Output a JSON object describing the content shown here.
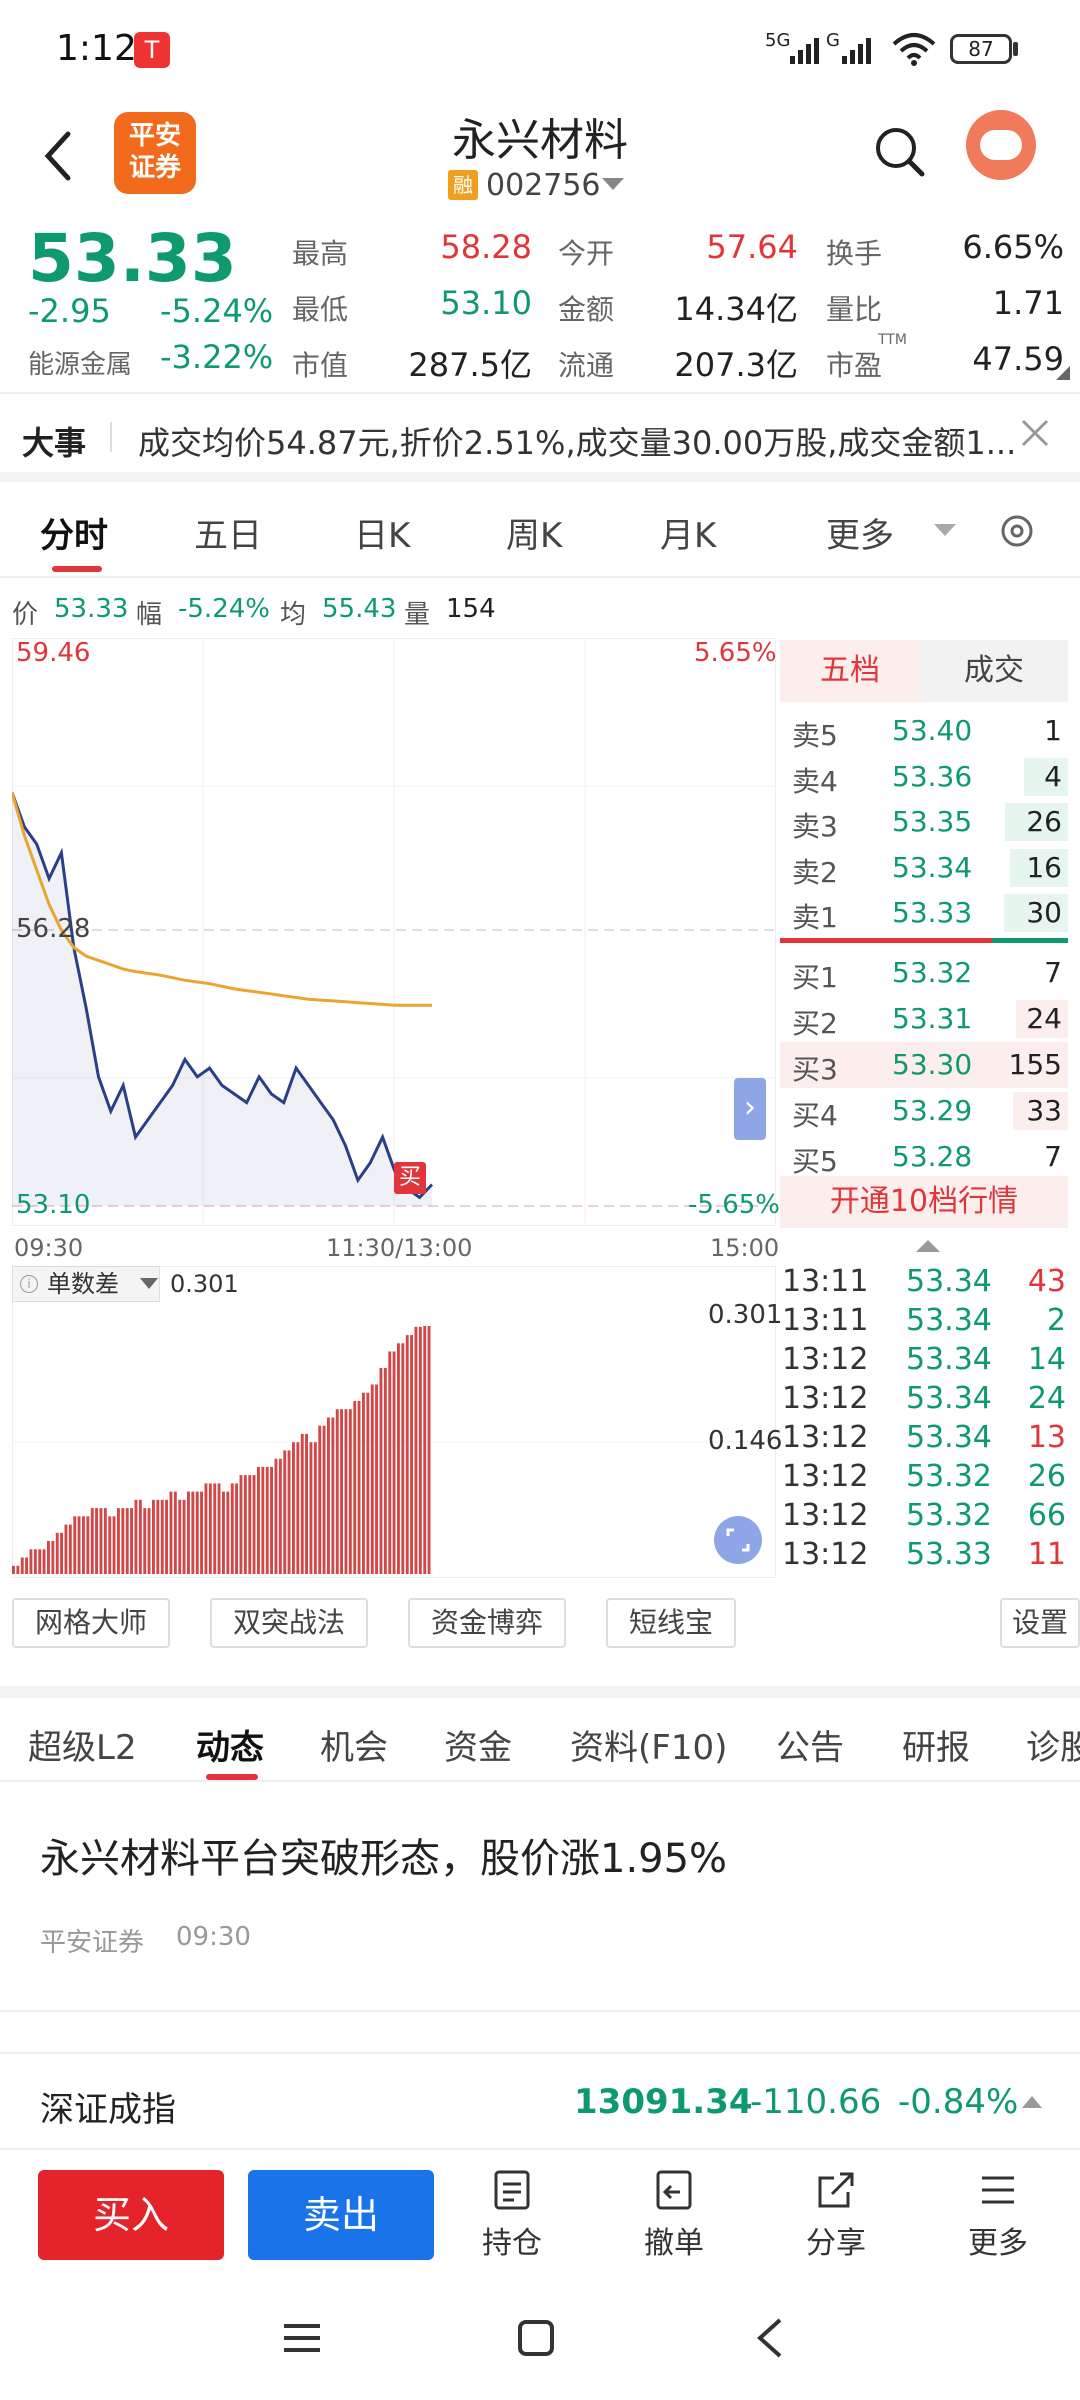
{
  "status_bar": {
    "time": "1:12",
    "battery": "87",
    "net1": "5G",
    "net2": "G"
  },
  "header": {
    "title": "永兴材料",
    "code": "002756",
    "margin_badge": "融",
    "broker_logo_line1": "平安",
    "broker_logo_line2": "证券"
  },
  "quote": {
    "price": "53.33",
    "change": "-2.95",
    "change_pct": "-5.24%",
    "sector": "能源金属",
    "sector_pct": "-3.22%",
    "fields": {
      "high_label": "最高",
      "high": "58.28",
      "open_label": "今开",
      "open": "57.64",
      "turnover_label": "换手",
      "turnover": "6.65%",
      "low_label": "最低",
      "low": "53.10",
      "amount_label": "金额",
      "amount": "14.34亿",
      "ratio_label": "量比",
      "ratio": "1.71",
      "mcap_label": "市值",
      "mcap": "287.5亿",
      "float_label": "流通",
      "float": "207.3亿",
      "pe_label": "市盈",
      "pe_sup": "TTM",
      "pe": "47.59"
    }
  },
  "event": {
    "label": "大事",
    "text": "成交均价54.87元,折价2.51%,成交量30.00万股,成交金额1..."
  },
  "chart_tabs": [
    "分时",
    "五日",
    "日K",
    "周K",
    "月K",
    "更多"
  ],
  "info_line": {
    "price_label": "价",
    "price": "53.33",
    "pct_label": "幅",
    "pct": "-5.24%",
    "avg_label": "均",
    "avg": "55.43",
    "vol_label": "量",
    "vol": "154"
  },
  "chart_data": {
    "type": "line",
    "y_top": "59.46",
    "y_mid": "56.28",
    "y_bottom": "53.10",
    "pct_top": "5.65%",
    "pct_bottom": "-5.65%",
    "x_labels": [
      "09:30",
      "11:30/13:00",
      "15:00"
    ],
    "ylim": [
      53.1,
      59.46
    ],
    "series": [
      {
        "name": "价",
        "values": [
          57.9,
          57.5,
          57.3,
          56.9,
          57.2,
          56.1,
          55.4,
          54.6,
          54.2,
          54.5,
          53.9,
          54.1,
          54.3,
          54.5,
          54.8,
          54.6,
          54.7,
          54.5,
          54.4,
          54.3,
          54.6,
          54.4,
          54.3,
          54.7,
          54.5,
          54.3,
          54.1,
          53.8,
          53.4,
          53.6,
          53.9,
          53.5,
          53.3,
          53.2,
          53.35
        ]
      },
      {
        "name": "均",
        "values": [
          57.9,
          57.4,
          57.0,
          56.6,
          56.3,
          56.1,
          56.0,
          55.95,
          55.9,
          55.85,
          55.82,
          55.8,
          55.78,
          55.75,
          55.72,
          55.7,
          55.68,
          55.65,
          55.62,
          55.6,
          55.58,
          55.56,
          55.54,
          55.52,
          55.5,
          55.49,
          55.48,
          55.47,
          55.46,
          55.45,
          55.44,
          55.43,
          55.43,
          55.43,
          55.43
        ]
      }
    ],
    "buy_marker": "买"
  },
  "indicator": {
    "name": "单数差",
    "value": "0.301",
    "axis_top": "0.301",
    "axis_mid": "0.146",
    "bars": [
      0.01,
      0.02,
      0.03,
      0.03,
      0.04,
      0.05,
      0.06,
      0.07,
      0.07,
      0.08,
      0.08,
      0.07,
      0.08,
      0.08,
      0.09,
      0.08,
      0.09,
      0.09,
      0.1,
      0.09,
      0.1,
      0.1,
      0.11,
      0.11,
      0.1,
      0.11,
      0.12,
      0.12,
      0.13,
      0.13,
      0.14,
      0.15,
      0.16,
      0.17,
      0.16,
      0.18,
      0.19,
      0.2,
      0.2,
      0.21,
      0.22,
      0.23,
      0.25,
      0.27,
      0.28,
      0.29,
      0.3,
      0.301
    ]
  },
  "orderbook": {
    "tab_active": "五档",
    "tab_other": "成交",
    "asks": [
      {
        "label": "卖5",
        "price": "53.40",
        "vol": "1"
      },
      {
        "label": "卖4",
        "price": "53.36",
        "vol": "4"
      },
      {
        "label": "卖3",
        "price": "53.35",
        "vol": "26"
      },
      {
        "label": "卖2",
        "price": "53.34",
        "vol": "16"
      },
      {
        "label": "卖1",
        "price": "53.33",
        "vol": "30"
      }
    ],
    "bids": [
      {
        "label": "买1",
        "price": "53.32",
        "vol": "7"
      },
      {
        "label": "买2",
        "price": "53.31",
        "vol": "24"
      },
      {
        "label": "买3",
        "price": "53.30",
        "vol": "155"
      },
      {
        "label": "买4",
        "price": "53.29",
        "vol": "33"
      },
      {
        "label": "买5",
        "price": "53.28",
        "vol": "7"
      }
    ],
    "upgrade": "开通10档行情"
  },
  "ticks": [
    {
      "time": "13:11",
      "price": "53.34",
      "vol": "43",
      "dir": "red"
    },
    {
      "time": "13:11",
      "price": "53.34",
      "vol": "2",
      "dir": "green"
    },
    {
      "time": "13:12",
      "price": "53.34",
      "vol": "14",
      "dir": "green"
    },
    {
      "time": "13:12",
      "price": "53.34",
      "vol": "24",
      "dir": "green"
    },
    {
      "time": "13:12",
      "price": "53.34",
      "vol": "13",
      "dir": "red"
    },
    {
      "time": "13:12",
      "price": "53.32",
      "vol": "26",
      "dir": "green"
    },
    {
      "time": "13:12",
      "price": "53.32",
      "vol": "66",
      "dir": "green"
    },
    {
      "time": "13:12",
      "price": "53.33",
      "vol": "11",
      "dir": "red"
    }
  ],
  "tools": [
    "网格大师",
    "双突战法",
    "资金博弈",
    "短线宝",
    "设置"
  ],
  "sub_tabs": [
    "超级L2",
    "动态",
    "机会",
    "资金",
    "资料(F10)",
    "公告",
    "研报",
    "诊股"
  ],
  "news": {
    "title": "永兴材料平台突破形态，股价涨1.95%",
    "source": "平安证券",
    "time": "09:30"
  },
  "index_bar": {
    "name": "深证成指",
    "value": "13091.34",
    "change": "-110.66",
    "pct": "-0.84%"
  },
  "actions": {
    "buy": "买入",
    "sell": "卖出",
    "items": [
      "持仓",
      "撤单",
      "分享",
      "更多"
    ]
  },
  "colors": {
    "up": "#e0353b",
    "down": "#0e9a6e",
    "price_line": "#2b3f86",
    "avg_line": "#e8a530",
    "buy_btn": "#e5232b",
    "sell_btn": "#1a73e8"
  }
}
